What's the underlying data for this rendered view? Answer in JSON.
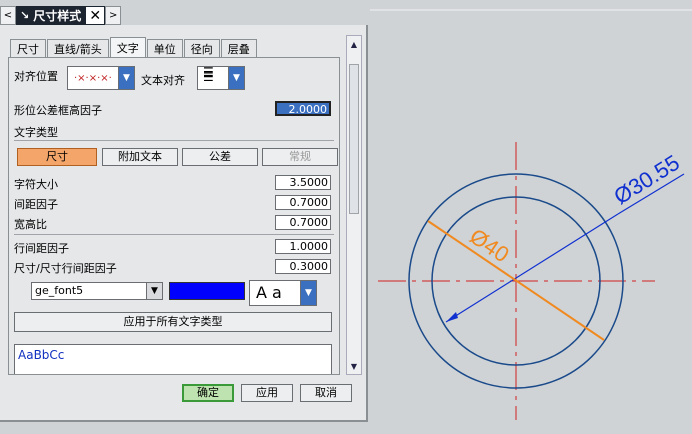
{
  "titlebar": {
    "title": "尺寸样式",
    "prev": "<",
    "next": ">",
    "close": "✕"
  },
  "tabs": [
    "尺寸",
    "直线/箭头",
    "文字",
    "单位",
    "径向",
    "层叠"
  ],
  "active_tab": "文字",
  "align": {
    "label": "对齐位置",
    "text_align_label": "文本对齐"
  },
  "tol_factor": {
    "label": "形位公差框高因子",
    "value": "2.0000"
  },
  "text_type": {
    "label": "文字类型",
    "buttons": [
      "尺寸",
      "附加文本",
      "公差",
      "常规"
    ]
  },
  "char_size": {
    "label": "字符大小",
    "value": "3.5000"
  },
  "spacing": {
    "label": "间距因子",
    "value": "0.7000"
  },
  "aspect": {
    "label": "宽高比",
    "value": "0.7000"
  },
  "line_spacing": {
    "label": "行间距因子",
    "value": "1.0000"
  },
  "dim_line_spacing": {
    "label": "尺寸/尺寸行间距因子",
    "value": "0.3000"
  },
  "font": {
    "name": "ge_font5",
    "color": "#0000ff",
    "style_preview": "A a"
  },
  "apply_all": "应用于所有文字类型",
  "preview_text": "AaBbCc",
  "footer": {
    "ok": "确定",
    "apply": "应用",
    "cancel": "取消"
  },
  "drawing": {
    "outer_dim": "Ø30.55",
    "inner_dim": "Ø40"
  }
}
